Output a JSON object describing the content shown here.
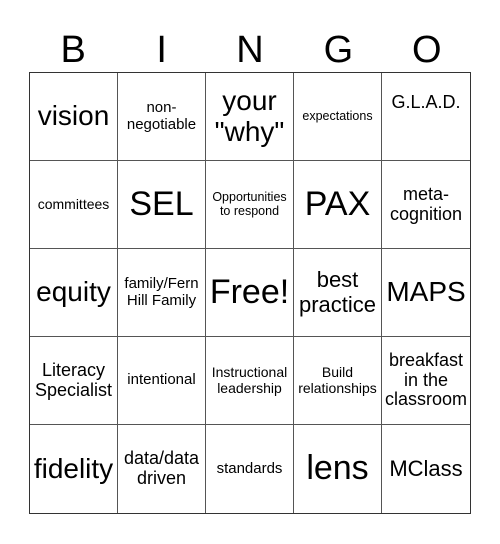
{
  "header": {
    "letters": [
      "B",
      "I",
      "N",
      "G",
      "O"
    ]
  },
  "board": {
    "rows": [
      [
        "vision",
        "non-\nnegotiable",
        "your \"why\"",
        "expectations",
        "G.L.A.D."
      ],
      [
        "committees",
        "SEL",
        "Opportunities to respond",
        "PAX",
        "meta-\ncognition"
      ],
      [
        "equity",
        "family/Fern Hill Family",
        "Free!",
        "best practice",
        "MAPS"
      ],
      [
        "Literacy Specialist",
        "intentional",
        "Instructional leadership",
        "Build relationships",
        "breakfast in the classroom"
      ],
      [
        "fidelity",
        "data/data driven",
        "standards",
        "lens",
        "MClass"
      ]
    ]
  }
}
